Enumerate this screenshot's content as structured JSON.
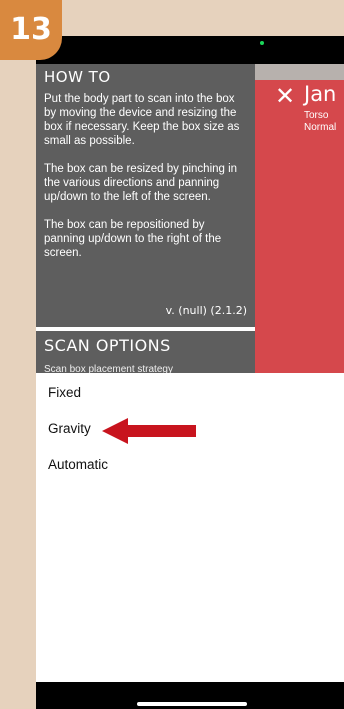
{
  "step_badge": "13",
  "howto": {
    "title": "HOW TO",
    "paragraphs": [
      "Put the body part to scan into the box by moving the device and resizing the box if necessary. Keep the box size as small as possible.",
      "The box can be resized by pinching in the various directions and panning up/down to the left of the screen.",
      "The box can be repositioned by panning up/down to the right of the screen."
    ],
    "version": "v. (null) (2.1.2)"
  },
  "scan_options": {
    "title": "SCAN OPTIONS",
    "subtitle": "Scan box placement strategy"
  },
  "patient": {
    "close_icon": "close-icon",
    "name": "Jan",
    "body_part": "Torso",
    "status": "Normal"
  },
  "sheet": {
    "options": [
      "Fixed",
      "Gravity",
      "Automatic"
    ]
  },
  "colors": {
    "badge": "#d9893f",
    "panel": "#5e5e5e",
    "accent_red": "#d5484c",
    "arrow": "#c8141e",
    "background": "#e6d2bd"
  }
}
